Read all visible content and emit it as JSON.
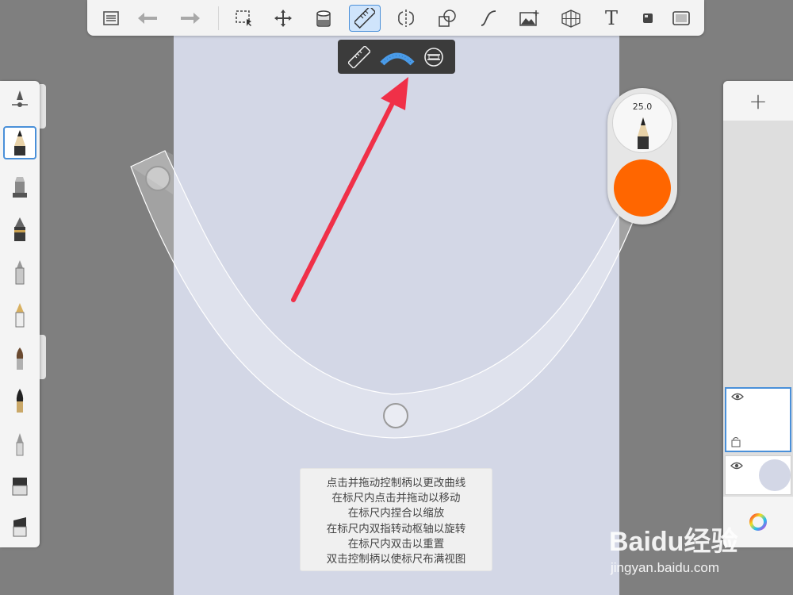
{
  "toolbar": {
    "buttons": [
      {
        "id": "list",
        "icon": "list-icon"
      },
      {
        "id": "undo",
        "icon": "undo-icon"
      },
      {
        "id": "redo",
        "icon": "redo-icon"
      },
      {
        "id": "selection",
        "icon": "selection-icon"
      },
      {
        "id": "transform",
        "icon": "move-icon"
      },
      {
        "id": "fill",
        "icon": "paint-bucket-icon"
      },
      {
        "id": "ruler",
        "icon": "ruler-icon",
        "active": true
      },
      {
        "id": "symmetry",
        "icon": "symmetry-icon"
      },
      {
        "id": "shapes",
        "icon": "shapes-icon"
      },
      {
        "id": "curve",
        "icon": "curve-icon"
      },
      {
        "id": "image",
        "icon": "image-add-icon"
      },
      {
        "id": "perspective",
        "icon": "perspective-grid-icon"
      },
      {
        "id": "text",
        "icon": "text-icon",
        "label": "T"
      },
      {
        "id": "brush-settings",
        "icon": "square-icon"
      },
      {
        "id": "fullscreen",
        "icon": "fullscreen-icon"
      }
    ]
  },
  "ruler_popup": {
    "options": [
      {
        "id": "straight",
        "icon": "straight-ruler-icon"
      },
      {
        "id": "french-curve",
        "icon": "french-curve-icon",
        "active": true
      },
      {
        "id": "ellipse",
        "icon": "ellipse-guide-icon"
      }
    ]
  },
  "brushes": [
    {
      "id": "brush-settings",
      "icon": "brush-slider-icon"
    },
    {
      "id": "pencil",
      "icon": "pencil-icon",
      "selected": true
    },
    {
      "id": "airbrush",
      "icon": "airbrush-icon"
    },
    {
      "id": "ballpoint",
      "icon": "ballpoint-pen-icon"
    },
    {
      "id": "marker",
      "icon": "marker-icon"
    },
    {
      "id": "fountain-pen",
      "icon": "fountain-pen-icon"
    },
    {
      "id": "paintbrush",
      "icon": "paintbrush-icon"
    },
    {
      "id": "ink-brush",
      "icon": "ink-brush-icon"
    },
    {
      "id": "smudge",
      "icon": "smudge-icon"
    },
    {
      "id": "eraser",
      "icon": "eraser-icon"
    },
    {
      "id": "soft-eraser",
      "icon": "soft-eraser-icon"
    }
  ],
  "brush_puck": {
    "size": "25.0",
    "color": "#ff6600"
  },
  "layers": {
    "add_label": "+",
    "items": [
      {
        "id": "layer-1",
        "visible": true,
        "selected": true
      },
      {
        "id": "background",
        "visible": true,
        "color": "#d3d7e6"
      }
    ]
  },
  "hint": {
    "lines": [
      "点击并拖动控制柄以更改曲线",
      "在标尺内点击并拖动以移动",
      "在标尺内捏合以缩放",
      "在标尺内双指转动枢轴以旋转",
      "在标尺内双击以重置",
      "双击控制柄以使标尺布满视图"
    ]
  },
  "watermark": {
    "logo": "Baidu经验",
    "url": "jingyan.baidu.com"
  },
  "colors": {
    "canvas": "#d3d7e6",
    "workspace": "#7f7f7f",
    "accent": "#4a90d9",
    "arrow": "#f03048"
  }
}
